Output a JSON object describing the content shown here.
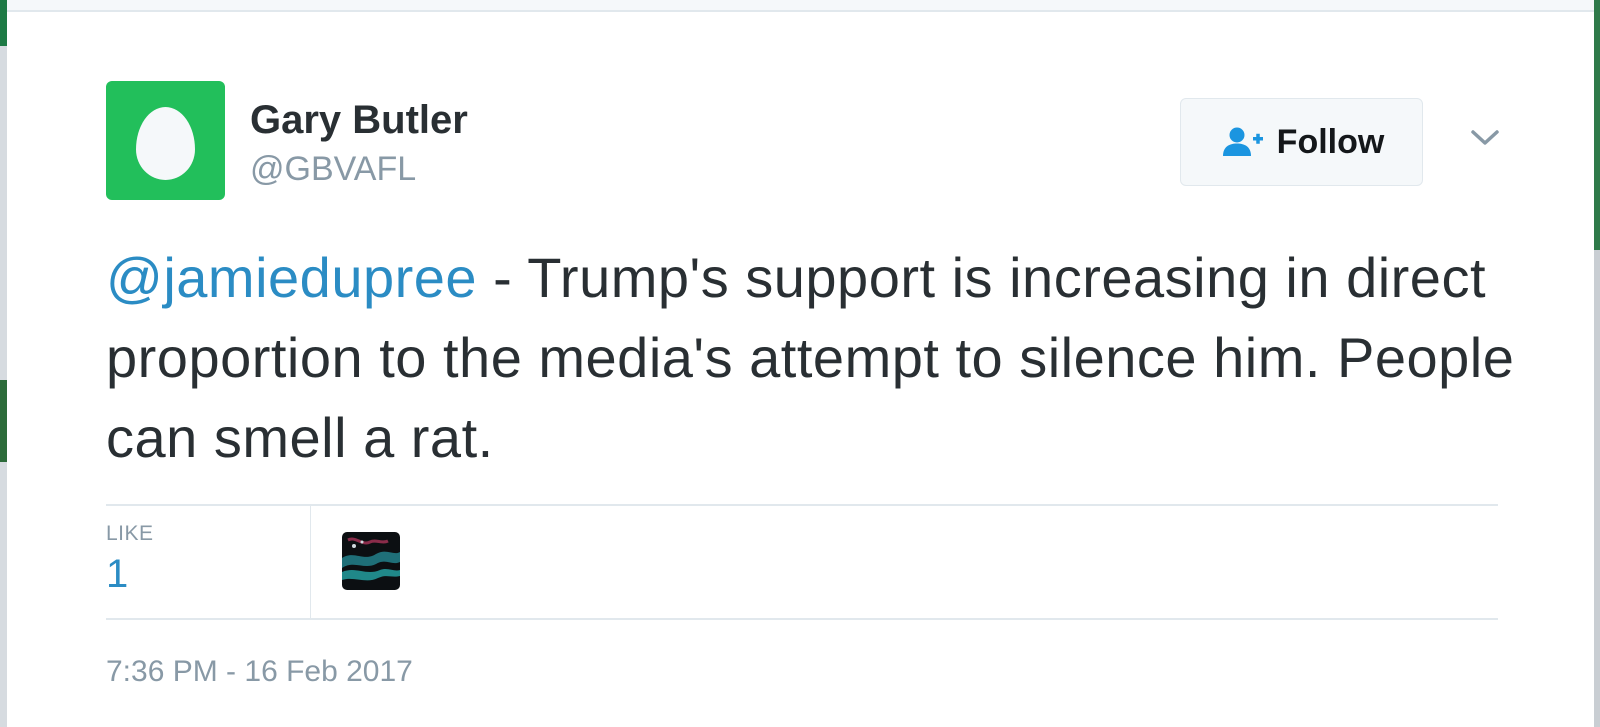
{
  "tweet": {
    "author": {
      "display_name": "Gary Butler",
      "screen_name": "@GBVAFL",
      "avatar_icon": "default-egg-avatar-icon",
      "avatar_color": "#22bf5b"
    },
    "follow_button": {
      "label": "Follow",
      "icon": "follow-user-icon"
    },
    "menu_icon": "chevron-down-icon",
    "text": {
      "mention": "@jamiedupree",
      "body": " - Trump's support is increasing in direct proportion to the media's attempt to silence him. People can smell a rat."
    },
    "stats": {
      "like_label": "LIKE",
      "like_count": "1"
    },
    "liker_avatar_icon": "liker-avatar-icon",
    "timestamp": "7:36 PM - 16 Feb 2017"
  },
  "colors": {
    "link": "#2b8cc4",
    "text": "#292f33",
    "muted": "#8899a6",
    "divider": "#e1e8ed"
  }
}
